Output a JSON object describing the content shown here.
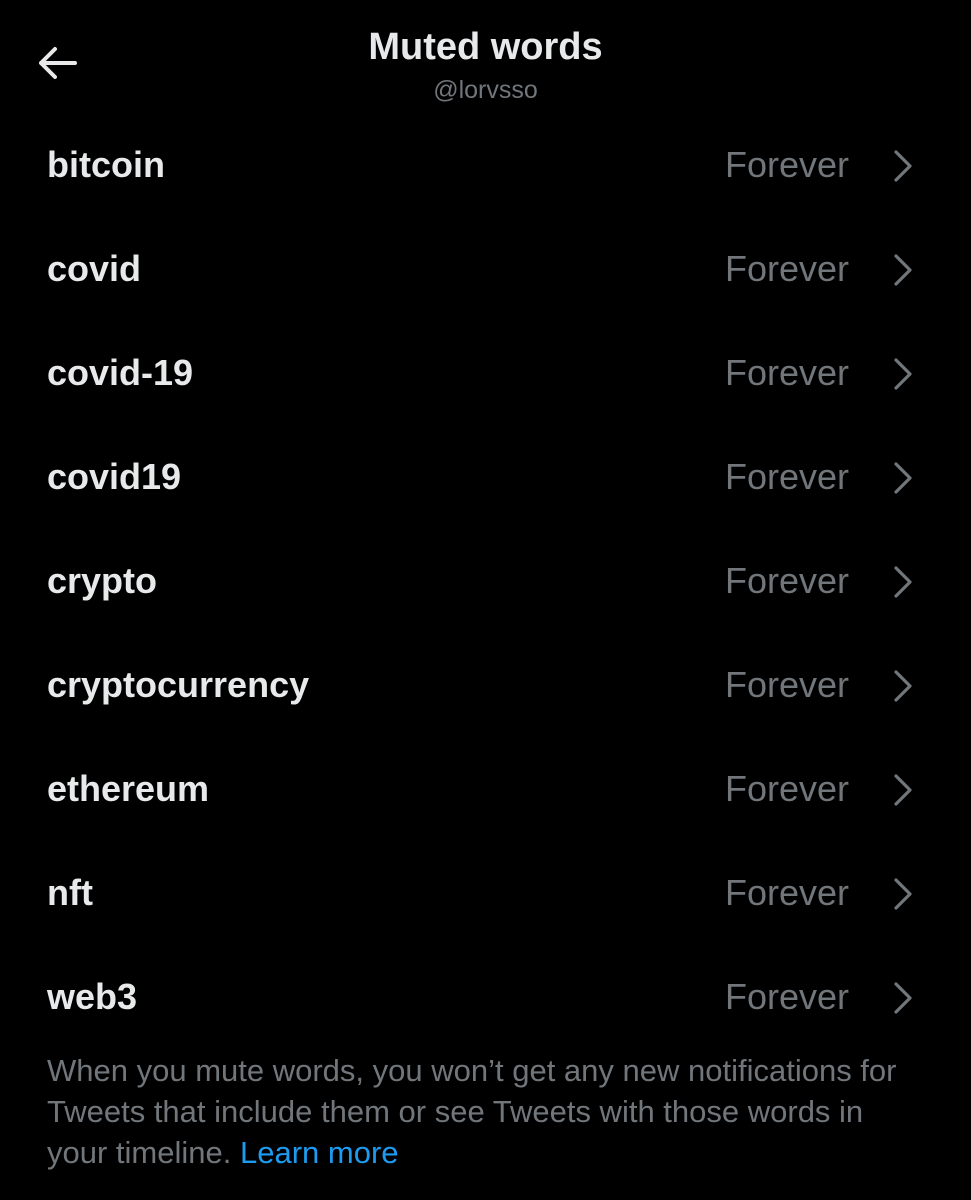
{
  "header": {
    "title": "Muted words",
    "subtitle": "@lorvsso",
    "back_icon": "arrow-left-icon"
  },
  "muted_words": [
    {
      "word": "bitcoin",
      "duration": "Forever"
    },
    {
      "word": "covid",
      "duration": "Forever"
    },
    {
      "word": "covid-19",
      "duration": "Forever"
    },
    {
      "word": "covid19",
      "duration": "Forever"
    },
    {
      "word": "crypto",
      "duration": "Forever"
    },
    {
      "word": "cryptocurrency",
      "duration": "Forever"
    },
    {
      "word": "ethereum",
      "duration": "Forever"
    },
    {
      "word": "nft",
      "duration": "Forever"
    },
    {
      "word": "web3",
      "duration": "Forever"
    }
  ],
  "footer": {
    "text": "When you mute words, you won’t get any new notifications for Tweets that include them or see Tweets with those words in your timeline.",
    "link_label": "Learn more"
  },
  "colors": {
    "background": "#000000",
    "primary_text": "#e7e9ea",
    "secondary_text": "#71767b",
    "link": "#1d9bf0"
  }
}
